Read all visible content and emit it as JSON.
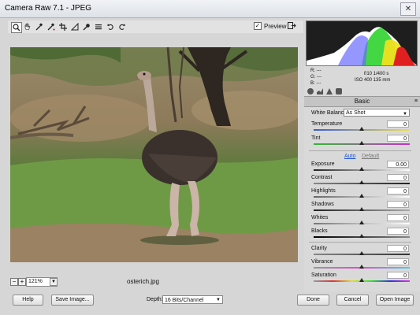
{
  "window": {
    "title": "Camera Raw 7.1  -  JPEG",
    "close_label": "✕"
  },
  "toolbar": {
    "tools": [
      "zoom-icon",
      "hand-icon",
      "white-balance-icon",
      "color-sampler-icon",
      "crop-icon",
      "straighten-icon",
      "spot-removal-icon",
      "preferences-icon",
      "rotate-ccw-icon",
      "rotate-cw-icon"
    ],
    "preview_label": "Preview",
    "preview_checked": true
  },
  "image": {
    "filename": "osterich.jpg",
    "zoom": "121%"
  },
  "histogram": {
    "info": {
      "r_label": "R:",
      "r_value": "---",
      "g_label": "G:",
      "g_value": "---",
      "b_label": "B:",
      "b_value": "---",
      "aperture": "f/10",
      "shutter": "1/400 s",
      "iso": "ISO 400",
      "focal": "135 mm"
    }
  },
  "panel": {
    "section_title": "Basic",
    "white_balance": {
      "label": "White Balance:",
      "value": "As Shot"
    },
    "auto_label": "Auto",
    "default_label": "Default",
    "sliders": [
      {
        "label": "Temperature",
        "value": "0"
      },
      {
        "label": "Tint",
        "value": "0"
      },
      {
        "label": "Exposure",
        "value": "0.00"
      },
      {
        "label": "Contrast",
        "value": "0"
      },
      {
        "label": "Highlights",
        "value": "0"
      },
      {
        "label": "Shadows",
        "value": "0"
      },
      {
        "label": "Whites",
        "value": "0"
      },
      {
        "label": "Blacks",
        "value": "0"
      },
      {
        "label": "Clarity",
        "value": "0"
      },
      {
        "label": "Vibrance",
        "value": "0"
      },
      {
        "label": "Saturation",
        "value": "0"
      }
    ]
  },
  "footer": {
    "help": "Help",
    "save_image": "Save Image...",
    "depth_label": "Depth:",
    "depth_value": "16 Bits/Channel",
    "done": "Done",
    "cancel": "Cancel",
    "open_image": "Open Image"
  }
}
